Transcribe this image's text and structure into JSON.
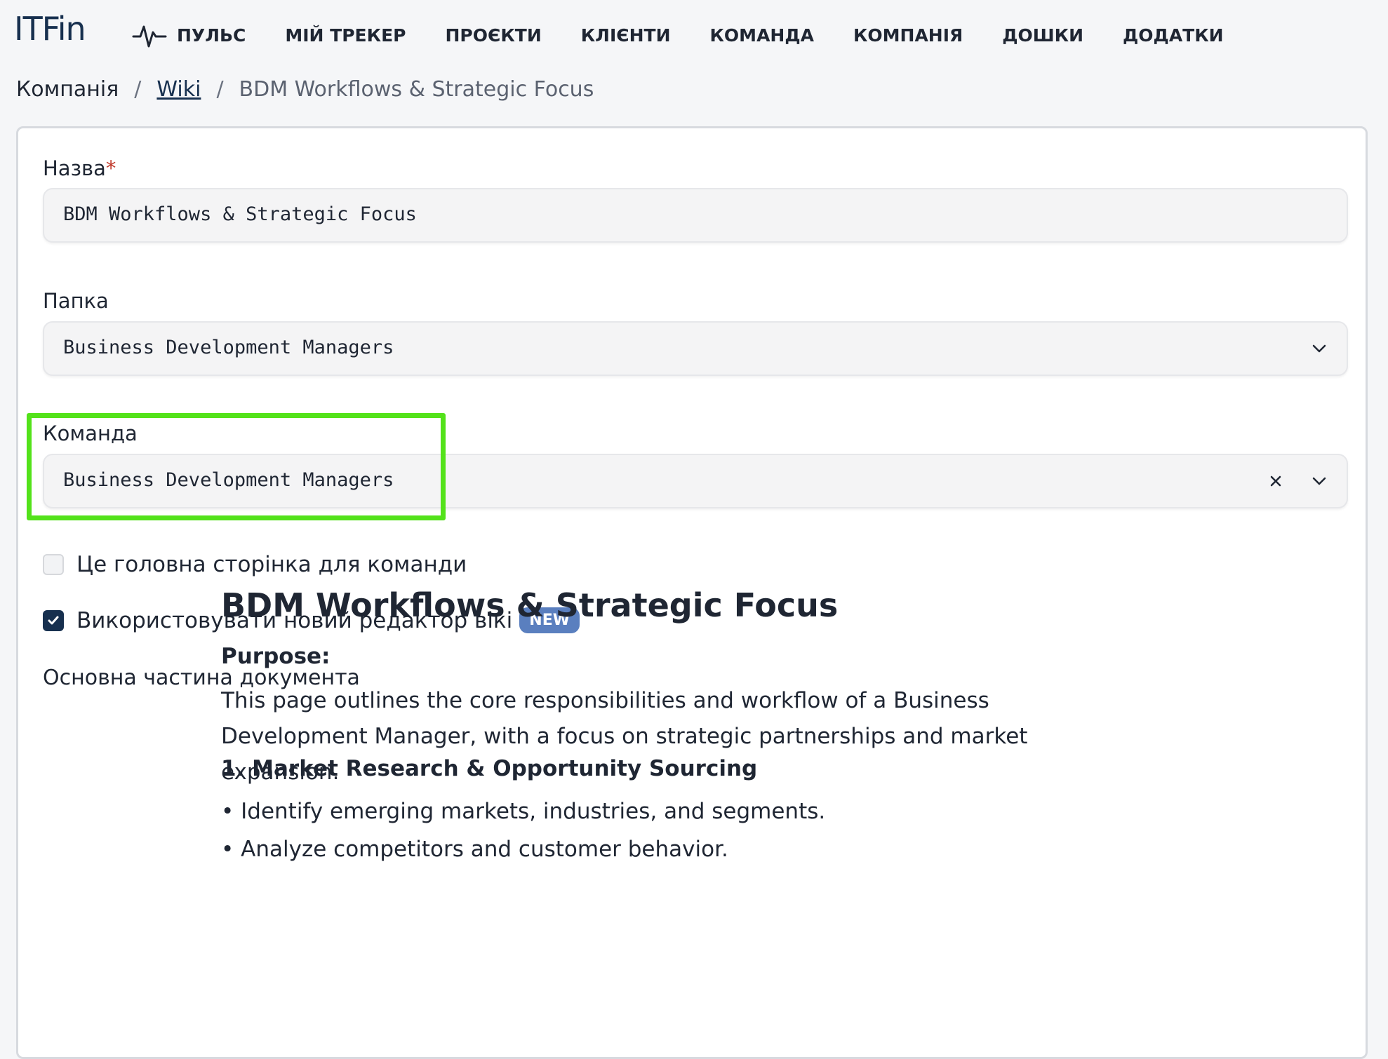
{
  "app": {
    "logo": "ITFin"
  },
  "nav": {
    "items": [
      {
        "label": "ПУЛЬС",
        "icon": "pulse-icon"
      },
      {
        "label": "МІЙ ТРЕКЕР"
      },
      {
        "label": "ПРОЄКТИ"
      },
      {
        "label": "КЛІЄНТИ"
      },
      {
        "label": "КОМАНДА"
      },
      {
        "label": "КОМПАНІЯ"
      },
      {
        "label": "ДОШКИ"
      },
      {
        "label": "ДОДАТКИ"
      }
    ]
  },
  "breadcrumb": {
    "root": "Компанія",
    "sep": "/",
    "link": "Wiki",
    "current": "BDM Workflows & Strategic Focus"
  },
  "form": {
    "name": {
      "label": "Назва",
      "required_mark": "*",
      "value": "BDM Workflows & Strategic Focus"
    },
    "folder": {
      "label": "Папка",
      "value": "Business Development Managers"
    },
    "team": {
      "label": "Команда",
      "value": "Business Development Managers"
    },
    "main_page_checkbox": {
      "label": "Це головна сторінка для команди",
      "checked": false
    },
    "new_editor_checkbox": {
      "label": "Використовувати новий редактор вікі",
      "checked": true,
      "badge": "NEW"
    },
    "body_label": "Основна частина документа"
  },
  "document": {
    "title": "BDM Workflows & Strategic Focus",
    "purpose_heading": "Purpose:",
    "purpose_text": "This page outlines the core responsibilities and workflow of a Business Development Manager, with a focus on strategic partnerships and market expansion.",
    "section1_heading": "1. Market Research & Opportunity Sourcing",
    "section1_items": [
      "• Identify emerging markets, industries, and segments.",
      "• Analyze competitors and customer behavior."
    ]
  },
  "colors": {
    "brand": "#17304f",
    "highlight": "#53e21a",
    "badge": "#5a7fbf",
    "required": "#c0392b"
  }
}
